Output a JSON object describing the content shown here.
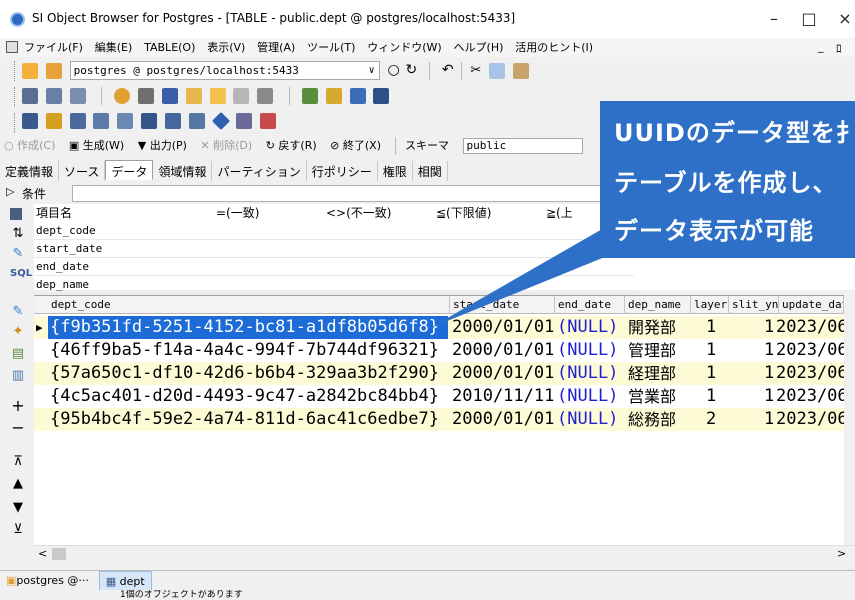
{
  "window": {
    "title": "SI Object Browser for Postgres - [TABLE - public.dept @ postgres/localhost:5433]",
    "controls": [
      "–",
      "□",
      "×"
    ]
  },
  "menubar": [
    "ファイル(F)",
    "編集(E)",
    "TABLE(O)",
    "表示(V)",
    "管理(A)",
    "ツール(T)",
    "ウィンドウ(W)",
    "ヘルプ(H)",
    "活用のヒント(I)"
  ],
  "toolbar": {
    "connection": "postgres @ postgres/localhost:5433"
  },
  "actions": {
    "create": "作成(C)",
    "generate": "生成(W)",
    "output": "出力(P)",
    "delete": "削除(D)",
    "back": "戻す(R)",
    "exit": "終了(X)",
    "schema_label": "スキーマ",
    "schema_value": "public"
  },
  "tabs": [
    "定義情報",
    "ソース",
    "データ",
    "領域情報",
    "パーティション",
    "行ポリシー",
    "権限",
    "相関"
  ],
  "active_tab": "データ",
  "condition_label": "条件",
  "filter_grid": {
    "headers": [
      "項目名",
      "=(一致)",
      "<>(不一致)",
      "≦(下限値)",
      "≧(上"
    ],
    "fields": [
      "dept_code",
      "start_date",
      "end_date",
      "dep_name"
    ]
  },
  "data_grid": {
    "columns": [
      "dept_code",
      "start_date",
      "end_date",
      "dep_name",
      "layer",
      "slit_yn",
      "update_date"
    ],
    "rows": [
      {
        "dept_code": "{f9b351fd-5251-4152-bc81-a1df8b05d6f8}",
        "start_date": "2000/01/01",
        "end_date": "(NULL)",
        "dep_name": "開発部",
        "layer": "1",
        "slit_yn": "1",
        "update_date": "2023/06"
      },
      {
        "dept_code": "{46ff9ba5-f14a-4a4c-994f-7b744df96321}",
        "start_date": "2000/01/01",
        "end_date": "(NULL)",
        "dep_name": "管理部",
        "layer": "1",
        "slit_yn": "1",
        "update_date": "2023/06"
      },
      {
        "dept_code": "{57a650c1-df10-42d6-b6b4-329aa3b2f290}",
        "start_date": "2000/01/01",
        "end_date": "(NULL)",
        "dep_name": "経理部",
        "layer": "1",
        "slit_yn": "1",
        "update_date": "2023/06"
      },
      {
        "dept_code": "{4c5ac401-d20d-4493-9c47-a2842bc84bb4}",
        "start_date": "2010/11/11",
        "end_date": "(NULL)",
        "dep_name": "営業部",
        "layer": "1",
        "slit_yn": "1",
        "update_date": "2023/06"
      },
      {
        "dept_code": "{95b4bc4f-59e2-4a74-811d-6ac41c6edbe7}",
        "start_date": "2000/01/01",
        "end_date": "(NULL)",
        "dep_name": "総務部",
        "layer": "2",
        "slit_yn": "1",
        "update_date": "2023/06"
      }
    ]
  },
  "doc_tabs": [
    "postgres @···",
    "dept"
  ],
  "status_text": "1個のオブジェクトがあります",
  "callout": {
    "lines": [
      "UUIDのデータ型を扌",
      "テーブルを作成し、",
      "データ表示が可能"
    ]
  },
  "colors": {
    "callout": "#2e6fc7",
    "selection": "#1c6bd6",
    "alt_row": "#fdfbd6",
    "null_text": "#2020d0"
  }
}
